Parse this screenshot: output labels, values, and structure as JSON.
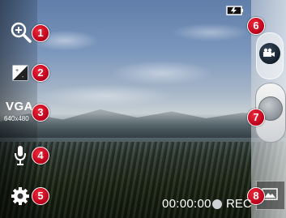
{
  "left_toolbar": {
    "zoom": {
      "icon": "zoom-in-icon",
      "badge": "1"
    },
    "brightness": {
      "icon": "brightness-icon",
      "badge": "2"
    },
    "video_size": {
      "label": "VGA",
      "sublabel": "640x480",
      "badge": "3"
    },
    "audio": {
      "icon": "microphone-icon",
      "badge": "4"
    },
    "settings": {
      "icon": "gear-icon",
      "badge": "5"
    }
  },
  "right_panel": {
    "mode_switch": {
      "icon": "video-camera-icon",
      "badge": "6"
    },
    "record_button": {
      "badge": "7"
    },
    "gallery": {
      "icon": "gallery-icon",
      "badge": "8"
    },
    "battery_icon": "battery-icon"
  },
  "recording": {
    "time": "00:00:00",
    "label": "REC"
  },
  "colors": {
    "badge_red": "#d0021b",
    "panel_white": "#ffffff"
  }
}
